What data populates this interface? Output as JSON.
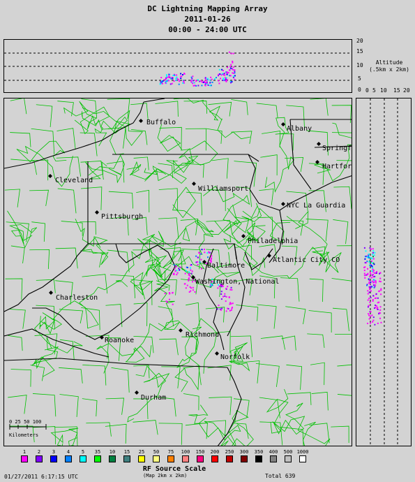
{
  "header": {
    "title": "DC Lightning Mapping Array",
    "date": "2011-01-26",
    "time_range": "00:00 - 24:00 UTC"
  },
  "altitude_panel": {
    "label_line1": "Altitude",
    "label_line2": "(.5km x 2km)",
    "ticks_vertical": [
      "20",
      "15",
      "10",
      "5",
      "0"
    ],
    "ticks_horizontal": [
      "0",
      "5",
      "10",
      "15",
      "20"
    ]
  },
  "cities": [
    {
      "name": "Buffalo"
    },
    {
      "name": "Albany"
    },
    {
      "name": "Springf"
    },
    {
      "name": "Hartfor"
    },
    {
      "name": "Cleveland"
    },
    {
      "name": "Williamsport"
    },
    {
      "name": "NYC La Guardia"
    },
    {
      "name": "Pittsburgh"
    },
    {
      "name": "Philadelphia"
    },
    {
      "name": "Baltimore"
    },
    {
      "name": "Atlantic City CO"
    },
    {
      "name": "Washington, National"
    },
    {
      "name": "Charleston"
    },
    {
      "name": "Richmond"
    },
    {
      "name": "Roanoke"
    },
    {
      "name": "Norfolk"
    },
    {
      "name": "Durham"
    }
  ],
  "scale_bar": {
    "ticks": "0 25 50   100",
    "unit": "Kilometers"
  },
  "legend": {
    "title": "RF Source Scale",
    "subtitle": "(Map 2km x 2km)",
    "items": [
      {
        "value": "1",
        "color": "#ff00ff"
      },
      {
        "value": "2",
        "color": "#8000ff"
      },
      {
        "value": "3",
        "color": "#0000ff"
      },
      {
        "value": "4",
        "color": "#0080ff"
      },
      {
        "value": "5",
        "color": "#00ffff"
      },
      {
        "value": "35",
        "color": "#00ff00"
      },
      {
        "value": "10",
        "color": "#008040"
      },
      {
        "value": "15",
        "color": "#408080"
      },
      {
        "value": "25",
        "color": "#ffff00"
      },
      {
        "value": "50",
        "color": "#ffff80"
      },
      {
        "value": "75",
        "color": "#ff8000"
      },
      {
        "value": "100",
        "color": "#ff8080"
      },
      {
        "value": "150",
        "color": "#ff0080"
      },
      {
        "value": "200",
        "color": "#ff0000"
      },
      {
        "value": "250",
        "color": "#c00000"
      },
      {
        "value": "300",
        "color": "#800000"
      },
      {
        "value": "350",
        "color": "#000000"
      },
      {
        "value": "400",
        "color": "#808080"
      },
      {
        "value": "500",
        "color": "#c0c0c0"
      },
      {
        "value": "1000",
        "color": "#ffffff"
      }
    ]
  },
  "footer": {
    "timestamp": "01/27/2011  6:17:15 UTC",
    "total": "Total 639"
  },
  "colors": {
    "background": "#d3d3d3",
    "county_lines": "#00c000",
    "state_lines": "#000000",
    "source_primary": "#ff00ff"
  }
}
